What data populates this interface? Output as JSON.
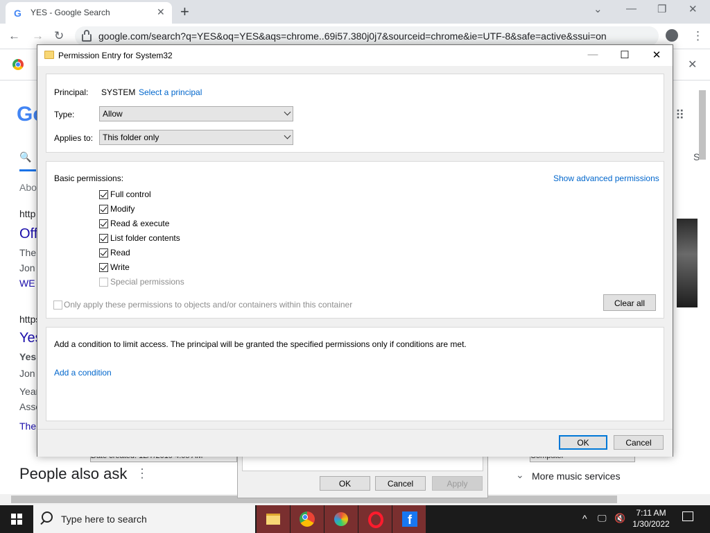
{
  "browser": {
    "tab_title": "YES - Google Search",
    "url": "google.com/search?q=YES&oq=YES&aqs=chrome..69i57.380j0j7&sourceid=chrome&ie=UTF-8&safe=active&ssui=on",
    "background_fragments": {
      "logo_partial": "Go",
      "about": "Abo",
      "http1": "http",
      "off": "Off",
      "the1": "The",
      "jon1": "Jon",
      "we": "WE",
      "https2": "https",
      "yes_link": "Yes",
      "yes_bold": "Yes",
      "jon2": "Jon",
      "year": "Year",
      "asso": "Asso",
      "the2": "The",
      "right_s": "S",
      "date_created": "Date created: 12/7/2019 4:05 AM",
      "computer": "Computer",
      "people_also_ask": "People also ask",
      "more_music": "More music services"
    }
  },
  "back_dialog": {
    "ok": "OK",
    "cancel": "Cancel",
    "apply": "Apply"
  },
  "dialog": {
    "title": "Permission Entry for System32",
    "principal_label": "Principal:",
    "principal_value": "SYSTEM",
    "select_principal": "Select a principal",
    "type_label": "Type:",
    "type_value": "Allow",
    "applies_label": "Applies to:",
    "applies_value": "This folder only",
    "basic_permissions_label": "Basic permissions:",
    "show_advanced": "Show advanced permissions",
    "permissions": [
      {
        "label": "Full control",
        "checked": true
      },
      {
        "label": "Modify",
        "checked": true
      },
      {
        "label": "Read & execute",
        "checked": true
      },
      {
        "label": "List folder contents",
        "checked": true
      },
      {
        "label": "Read",
        "checked": true
      },
      {
        "label": "Write",
        "checked": true
      },
      {
        "label": "Special permissions",
        "checked": false,
        "disabled": true
      }
    ],
    "only_apply": "Only apply these permissions to objects and/or containers within this container",
    "clear_all": "Clear all",
    "condition_text": "Add a condition to limit access. The principal will be granted the specified permissions only if conditions are met.",
    "add_condition": "Add a condition",
    "ok": "OK",
    "cancel": "Cancel"
  },
  "taskbar": {
    "search_placeholder": "Type here to search",
    "time": "7:11 AM",
    "date": "1/30/2022"
  }
}
